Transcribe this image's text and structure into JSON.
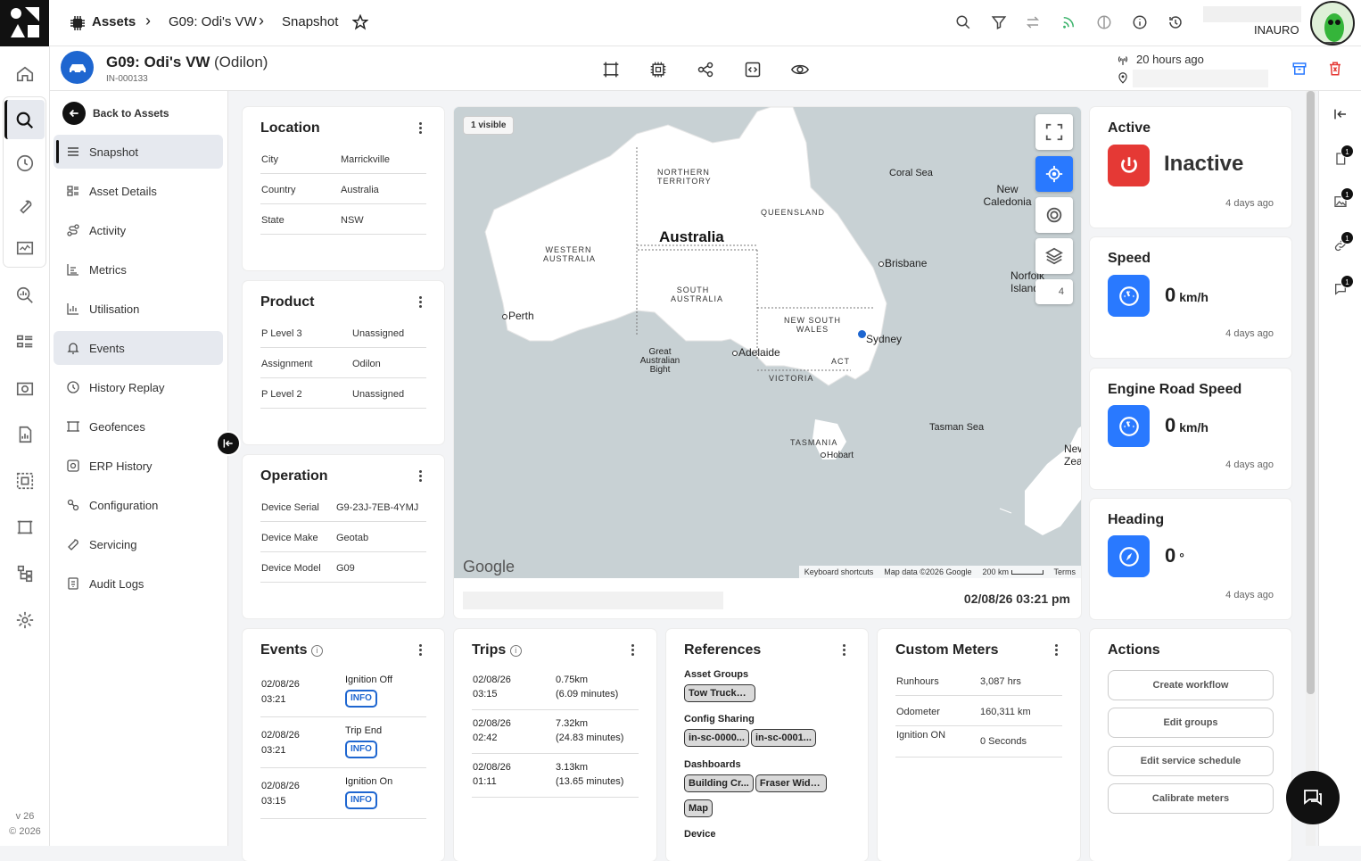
{
  "topbar": {
    "crumb_assets": "Assets",
    "crumb_asset": "G09: Odi's VW",
    "crumb_page": "Snapshot",
    "org_name": "INAURO"
  },
  "asset": {
    "name": "G09: Odi's VW",
    "owner": "(Odilon)",
    "id": "IN-000133",
    "last_seen": "20 hours ago"
  },
  "sidenav": {
    "back_label": "Back to Assets",
    "items": [
      {
        "label": "Snapshot",
        "icon": "list-icon"
      },
      {
        "label": "Asset Details",
        "icon": "details-icon"
      },
      {
        "label": "Activity",
        "icon": "activity-icon"
      },
      {
        "label": "Metrics",
        "icon": "metrics-icon"
      },
      {
        "label": "Utilisation",
        "icon": "chart-icon"
      },
      {
        "label": "Events",
        "icon": "bell-icon"
      },
      {
        "label": "History Replay",
        "icon": "history-icon"
      },
      {
        "label": "Geofences",
        "icon": "geofence-icon"
      },
      {
        "label": "ERP History",
        "icon": "erp-icon"
      },
      {
        "label": "Configuration",
        "icon": "config-icon"
      },
      {
        "label": "Servicing",
        "icon": "wrench-icon"
      },
      {
        "label": "Audit Logs",
        "icon": "audit-icon"
      }
    ]
  },
  "version": {
    "line1": "v 26",
    "line2": "© 2026"
  },
  "location": {
    "title": "Location",
    "rows": [
      {
        "k": "City",
        "v": "Marrickville"
      },
      {
        "k": "Country",
        "v": "Australia"
      },
      {
        "k": "State",
        "v": "NSW"
      }
    ]
  },
  "product": {
    "title": "Product",
    "rows": [
      {
        "k": "P Level 3",
        "v": "Unassigned"
      },
      {
        "k": "Assignment",
        "v": "Odilon"
      },
      {
        "k": "P Level 2",
        "v": "Unassigned"
      }
    ]
  },
  "operation": {
    "title": "Operation",
    "rows": [
      {
        "k": "Device Serial",
        "v": "G9-23J-7EB-4YMJ"
      },
      {
        "k": "Device Make",
        "v": "Geotab"
      },
      {
        "k": "Device Model",
        "v": "G09"
      }
    ]
  },
  "map": {
    "visible_badge": "1 visible",
    "country_label": "Australia",
    "regions": [
      "NORTHERN TERRITORY",
      "QUEENSLAND",
      "WESTERN AUSTRALIA",
      "SOUTH AUSTRALIA",
      "NEW SOUTH WALES",
      "VICTORIA",
      "ACT",
      "TASMANIA"
    ],
    "cities": [
      "Perth",
      "Brisbane",
      "Sydney",
      "Adelaide",
      "Hobart"
    ],
    "seas": [
      "Coral Sea",
      "Tasman Sea",
      "Great Australian Bight",
      "New Caledonia",
      "Norfolk Island",
      "New Zealand"
    ],
    "layer_count": "4",
    "google": "Google",
    "attribution": [
      "Keyboard shortcuts",
      "Map data ©2026 Google",
      "200 km",
      "Terms"
    ],
    "timestamp": "02/08/26 03:21 pm"
  },
  "status": {
    "active": {
      "title": "Active",
      "value": "Inactive",
      "ago": "4 days ago",
      "color": "#e53935"
    },
    "speed": {
      "title": "Speed",
      "value": "0",
      "unit": "km/h",
      "ago": "4 days ago"
    },
    "engine": {
      "title": "Engine Road Speed",
      "value": "0",
      "unit": "km/h",
      "ago": "4 days ago"
    },
    "heading": {
      "title": "Heading",
      "value": "0",
      "unit": "°",
      "ago": "4 days ago"
    },
    "accent": "#2979ff"
  },
  "events": {
    "title": "Events",
    "rows": [
      {
        "date": "02/08/26",
        "time": "03:21",
        "label": "Ignition Off",
        "level": "INFO"
      },
      {
        "date": "02/08/26",
        "time": "03:21",
        "label": "Trip End",
        "level": "INFO"
      },
      {
        "date": "02/08/26",
        "time": "03:15",
        "label": "Ignition On",
        "level": "INFO"
      }
    ]
  },
  "trips": {
    "title": "Trips",
    "rows": [
      {
        "date": "02/08/26",
        "time": "03:15",
        "dist": "0.75km",
        "dur": "(6.09 minutes)"
      },
      {
        "date": "02/08/26",
        "time": "02:42",
        "dist": "7.32km",
        "dur": "(24.83 minutes)"
      },
      {
        "date": "02/08/26",
        "time": "01:11",
        "dist": "3.13km",
        "dur": "(13.65 minutes)"
      }
    ]
  },
  "references": {
    "title": "References",
    "asset_groups_label": "Asset Groups",
    "asset_groups": [
      "Tow Trucks ..."
    ],
    "config_label": "Config Sharing",
    "config": [
      "in-sc-0000...",
      "in-sc-0001..."
    ],
    "dashboards_label": "Dashboards",
    "dashboards": [
      "Building Cr...",
      "Fraser Widg...",
      "Map"
    ],
    "device_label": "Device"
  },
  "meters": {
    "title": "Custom Meters",
    "rows": [
      {
        "k": "Runhours",
        "v": "3,087 hrs"
      },
      {
        "k": "Odometer",
        "v": "160,311 km"
      },
      {
        "k": "Ignition ON",
        "v": "0 Seconds"
      }
    ]
  },
  "actions": {
    "title": "Actions",
    "buttons": [
      "Create workflow",
      "Edit groups",
      "Edit service schedule",
      "Calibrate meters"
    ]
  },
  "right_rail": {
    "badge": "1"
  }
}
